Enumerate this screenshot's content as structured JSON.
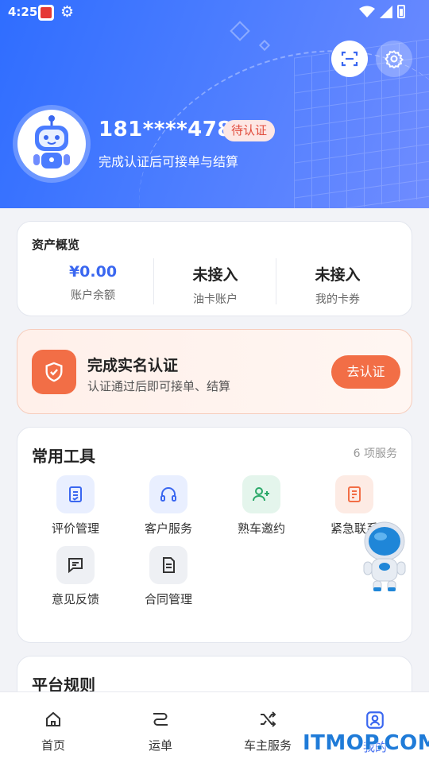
{
  "status_bar": {
    "time": "4:25",
    "icons": [
      "app-icon",
      "gear-icon",
      "wifi-icon",
      "signal-icon",
      "battery-icon"
    ]
  },
  "profile": {
    "phone": "181****4786",
    "badge": "待认证",
    "subtitle": "完成认证后可接单与结算"
  },
  "assets": {
    "title": "资产概览",
    "items": [
      {
        "value": "¥0.00",
        "label": "账户余额"
      },
      {
        "value": "未接入",
        "label": "油卡账户"
      },
      {
        "value": "未接入",
        "label": "我的卡券"
      }
    ]
  },
  "verify": {
    "title": "完成实名认证",
    "subtitle": "认证通过后即可接单、结算",
    "button": "去认证"
  },
  "tools": {
    "title": "常用工具",
    "count": "6 项服务",
    "items": [
      {
        "label": "评价管理",
        "icon": "clipboard-icon"
      },
      {
        "label": "客户服务",
        "icon": "headset-icon"
      },
      {
        "label": "熟车邀约",
        "icon": "add-user-icon"
      },
      {
        "label": "紧急联系",
        "icon": "note-icon"
      },
      {
        "label": "意见反馈",
        "icon": "feedback-icon"
      },
      {
        "label": "合同管理",
        "icon": "document-icon"
      }
    ]
  },
  "rules": {
    "title": "平台规则"
  },
  "tabbar": {
    "items": [
      {
        "label": "首页",
        "icon": "home-icon"
      },
      {
        "label": "运单",
        "icon": "route-icon"
      },
      {
        "label": "车主服务",
        "icon": "shuffle-icon"
      },
      {
        "label": "我的",
        "icon": "profile-icon"
      }
    ]
  },
  "watermark": "ITMOP.COM",
  "colors": {
    "primary": "#3a67f0",
    "accent": "#f26e46",
    "badge_text": "#e14b3b"
  }
}
